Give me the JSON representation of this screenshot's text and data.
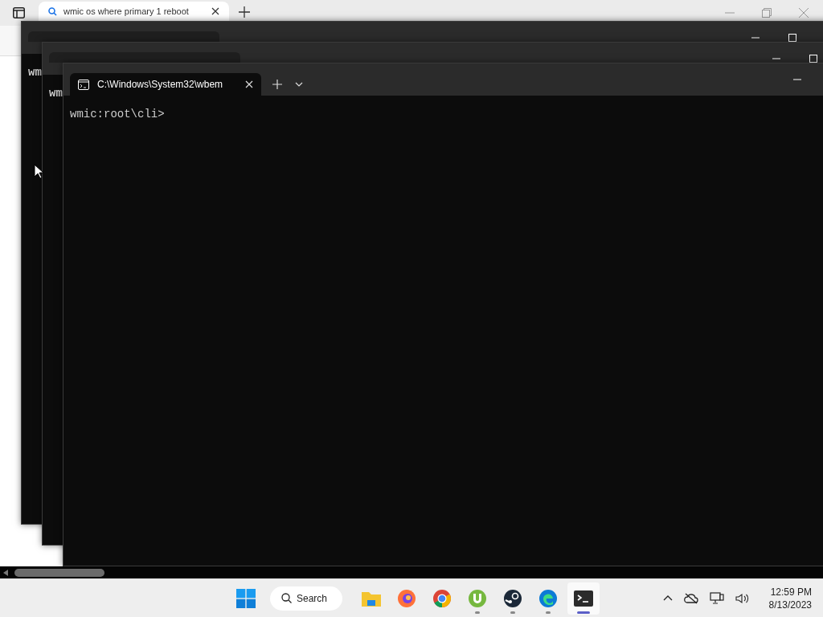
{
  "browser": {
    "tab_title": "wmic os where primary 1 reboot"
  },
  "terminals": [
    {
      "text": "wm",
      "controls": [
        {
          "kind": "minimize"
        },
        {
          "kind": "maximize"
        }
      ]
    },
    {
      "text": "wm",
      "controls": [
        {
          "kind": "minimize"
        },
        {
          "kind": "maximize"
        }
      ]
    },
    {
      "tab_title": "C:\\Windows\\System32\\wbem",
      "text": "wmic:root\\cli>",
      "controls": [
        {
          "kind": "minimize"
        }
      ]
    }
  ],
  "taskbar": {
    "search_label": "Search",
    "apps": [
      {
        "kind": "files",
        "running": false,
        "selected": false
      },
      {
        "kind": "firefox",
        "running": false,
        "selected": false
      },
      {
        "kind": "chrome",
        "running": false,
        "selected": false
      },
      {
        "kind": "utorrent",
        "running": true,
        "selected": false
      },
      {
        "kind": "steam",
        "running": true,
        "selected": false
      },
      {
        "kind": "edge",
        "running": true,
        "selected": false
      },
      {
        "kind": "terminal",
        "running": true,
        "selected": true
      }
    ],
    "time": "12:59 PM",
    "date": "8/13/2023"
  }
}
